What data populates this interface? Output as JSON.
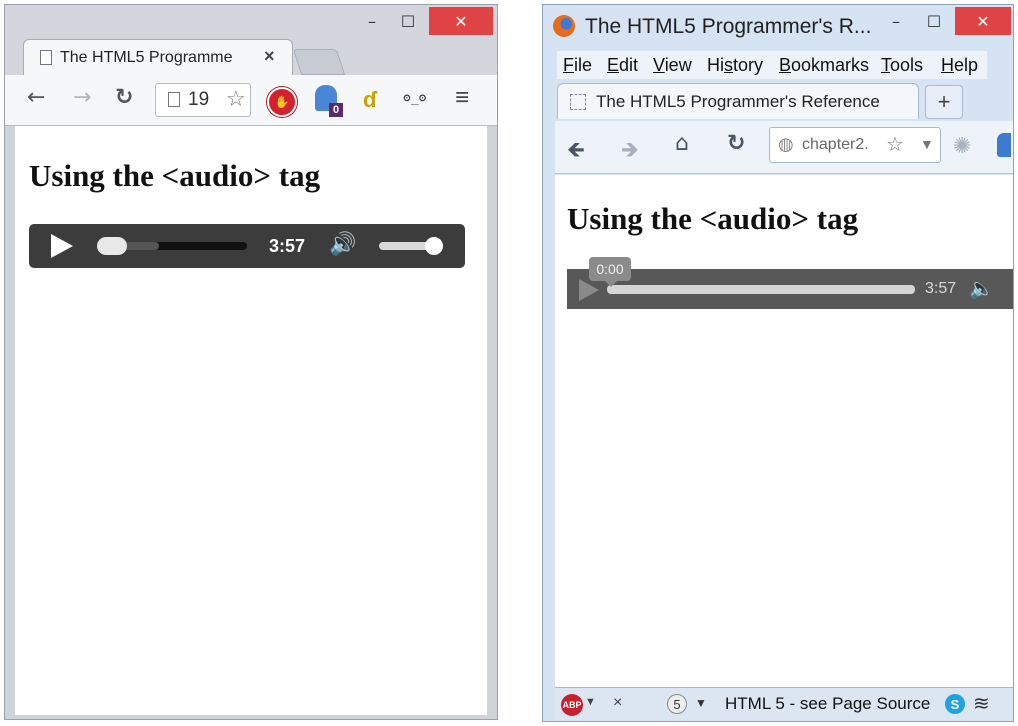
{
  "chrome": {
    "tab_title": "The HTML5 Programme",
    "tab_close": "×",
    "window_controls": {
      "minimize": "–",
      "maximize": "☐",
      "close": "✕"
    },
    "address_text": "19",
    "ext_badge": "0",
    "ext_face": "ʘ_ʘ",
    "page": {
      "heading": "Using the <audio> tag",
      "player": {
        "time": "3:57",
        "progress": 0.0,
        "volume": 0.95
      }
    }
  },
  "firefox": {
    "window_title": "The HTML5 Programmer's R...",
    "window_controls": {
      "minimize": "–",
      "maximize": "☐",
      "close": "✕"
    },
    "menu": [
      {
        "acc": "F",
        "rest": "ile"
      },
      {
        "acc": "E",
        "rest": "dit"
      },
      {
        "acc": "V",
        "rest": "iew"
      },
      {
        "pre": "Hi",
        "acc": "s",
        "rest": "tory"
      },
      {
        "acc": "B",
        "rest": "ookmarks"
      },
      {
        "acc": "T",
        "rest": "ools"
      },
      {
        "acc": "H",
        "rest": "elp"
      }
    ],
    "tab_title": "The HTML5 Programmer's Reference",
    "new_tab": "+",
    "url_text": "chapter2.",
    "page": {
      "heading": "Using the <audio> tag",
      "player": {
        "current_time": "0:00",
        "time": "3:57",
        "progress": 0.0
      }
    },
    "status": {
      "abp": "ABP",
      "close": "×",
      "count": "5",
      "text": "HTML 5 - see Page Source",
      "skype": "S"
    }
  }
}
